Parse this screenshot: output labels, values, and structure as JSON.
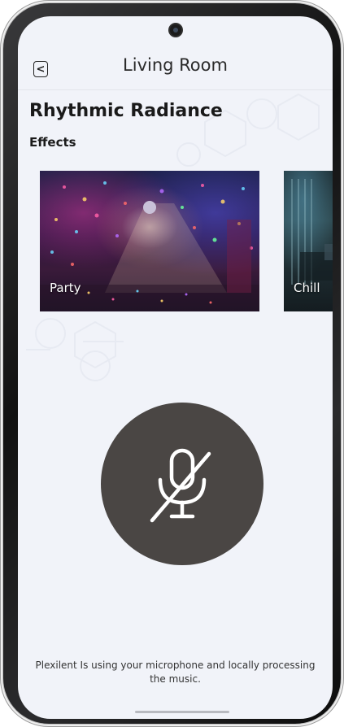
{
  "header": {
    "title": "Living Room",
    "back_icon": "chevron-left-icon",
    "back_glyph": "<"
  },
  "scene": {
    "title": "Rhythmic Radiance"
  },
  "effects": {
    "section_label": "Effects",
    "items": [
      {
        "label": "Party"
      },
      {
        "label": "Chill"
      }
    ]
  },
  "microphone": {
    "icon": "microphone-muted-icon",
    "state": "muted",
    "button_color": "#4a4644"
  },
  "footer": {
    "message": "Plexilent Is using your microphone and locally processing the music."
  },
  "theme": {
    "background": "#f1f3f9",
    "text": "#1a1a1a"
  }
}
